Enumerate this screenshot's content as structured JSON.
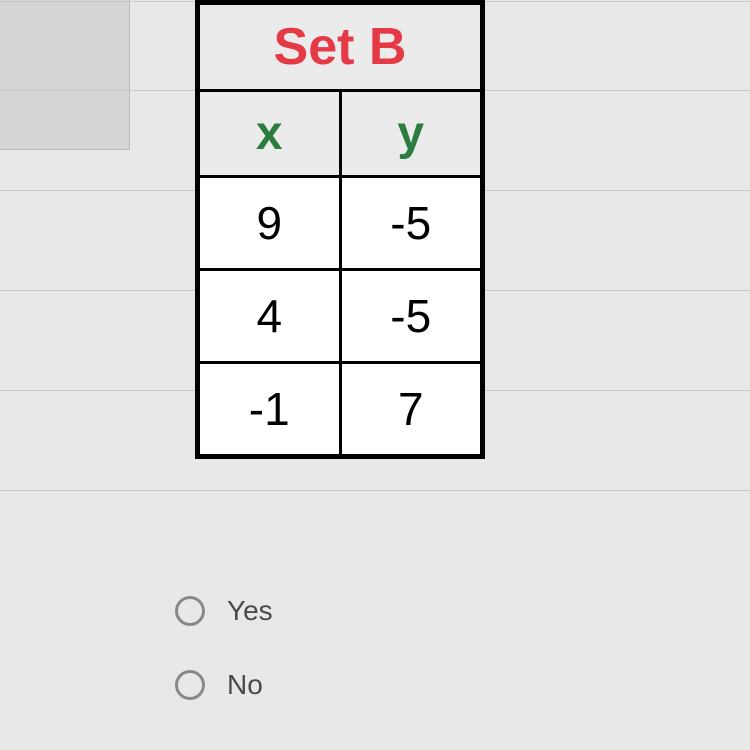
{
  "table": {
    "title": "Set B",
    "headers": {
      "x": "x",
      "y": "y"
    },
    "rows": [
      {
        "x": "9",
        "y": "-5"
      },
      {
        "x": "4",
        "y": "-5"
      },
      {
        "x": "-1",
        "y": "7"
      }
    ]
  },
  "options": [
    {
      "label": "Yes"
    },
    {
      "label": "No"
    }
  ],
  "chart_data": {
    "type": "table",
    "title": "Set B",
    "columns": [
      "x",
      "y"
    ],
    "data": [
      {
        "x": 9,
        "y": -5
      },
      {
        "x": 4,
        "y": -5
      },
      {
        "x": -1,
        "y": 7
      }
    ]
  }
}
